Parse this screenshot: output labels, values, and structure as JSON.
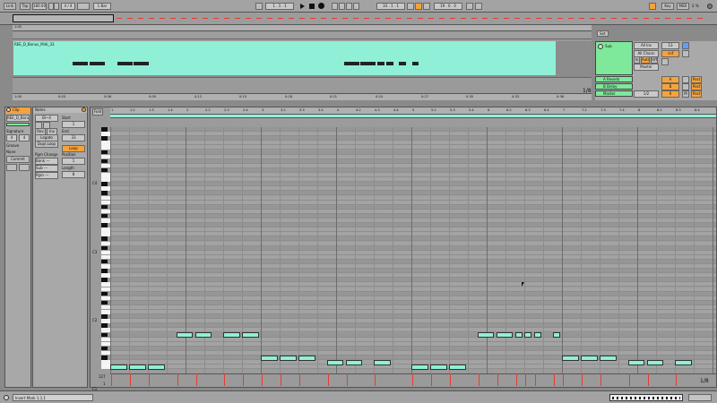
{
  "transport": {
    "link": "Link",
    "tap": "Tap",
    "tempo": "180.00",
    "time_signature": "4 / 4",
    "quantize": "1 Bar",
    "arrangement_position": "1 . 1 . 1",
    "loop_start": "33 . 1 . 1",
    "loop_length": "19 . 0 . 0"
  },
  "right_controls": {
    "key": "Key",
    "midi": "MIDI",
    "cpu": "2 %"
  },
  "arranger": {
    "clip_name": "REE_D_Bonus_Midi_33",
    "ruler_labels": [
      "1:00",
      "0:03",
      "0:06",
      "0:09",
      "0:12",
      "0:15",
      "0:18",
      "0:21",
      "0:24",
      "0:27",
      "0:30",
      "0:33",
      "0:36"
    ],
    "zoom": "1/8"
  },
  "mixer": {
    "set_label": "Set",
    "track_name": "Sub",
    "input_type": "All Ins",
    "input_channel": "All Chann",
    "monitor_in": "In",
    "monitor_auto": "Auto",
    "monitor_off": "Off",
    "output": "Master",
    "track_number": "13",
    "volume": "-inf",
    "sends": [
      {
        "name": "A Reverb",
        "letter": "A",
        "post": "Post"
      },
      {
        "name": "B Delay",
        "letter": "B",
        "post": "Post"
      }
    ],
    "master": {
      "name": "Master",
      "value": "1/2",
      "volume": "0",
      "letter": "M",
      "post": "Post"
    }
  },
  "clip_panel": {
    "title": "Clip",
    "clip_name": "REE_D_Bonu",
    "signature_label": "Signature",
    "sig_num": "4",
    "sig_den": "4",
    "groove_label": "Groove",
    "groove_value": "None",
    "commit": "Commit"
  },
  "notes_panel": {
    "title": "Notes",
    "fold_amount": "Bl~4",
    "rev": "Rev",
    "inv": "Inv",
    "legato": "Legato",
    "dupe_loop": "Dupl.Loop",
    "start_label": "Start",
    "end_label": "End",
    "loop_label": "Loop",
    "position_label": "Position",
    "length_label": "Length",
    "pgm_label": "Pgm Change",
    "bank": "Bank ---",
    "sub": "Sub ---",
    "pgm": "Pgm ---",
    "start_val": "1",
    "end_val": "33",
    "pos_val": "1",
    "len_val": "8"
  },
  "editor": {
    "fold_button": "Fold",
    "octave_labels": [
      {
        "label": "C4",
        "row": 12
      },
      {
        "label": "C3",
        "row": 27
      },
      {
        "label": "C2",
        "row": 42
      },
      {
        "label": "C1",
        "row": 57
      }
    ],
    "ruler_labels": [
      "1",
      "1.2",
      "1.3",
      "1.4",
      "2",
      "2.2",
      "2.3",
      "2.4",
      "3",
      "3.2",
      "3.3",
      "3.4",
      "4",
      "4.2",
      "4.3",
      "4.4",
      "5",
      "5.2",
      "5.3",
      "5.4",
      "6",
      "6.2",
      "6.3",
      "6.4",
      "7",
      "7.2",
      "7.3",
      "7.4",
      "8",
      "8.2",
      "8.3",
      "8.4"
    ],
    "velocity_label": "127",
    "velocity_low": "1",
    "zoom": "1/8"
  },
  "status": {
    "message": "Insert Mark 1.1.1"
  }
}
